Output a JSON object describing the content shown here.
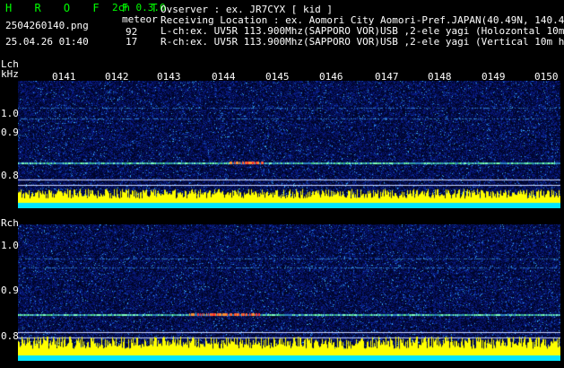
{
  "app_title": "H R O F F T",
  "mode": "2ch 0.3.0",
  "meteor_label": "meteor",
  "filename": "2504260140.png",
  "datetime": "25.04.26 01:40",
  "meteor_counts": {
    "lch": "92",
    "rch": "17"
  },
  "info": {
    "observer": "Ovserver             : ex. JR7CYX [ kid ]",
    "location": "Receiving Location : ex. Aomori City Aomori-Pref.JAPAN(40.49N, 140.47E)",
    "lch": "L-ch:ex. UV5R 113.900Mhz(SAPPORO VOR)USB ,2-ele yagi (Holozontal 10m height)",
    "rch": "R-ch:ex. UV5R 113.900Mhz(SAPPORO VOR)USB ,2-ele yagi (Vertical 10m height)"
  },
  "panels": {
    "lch": {
      "label": "Lch",
      "unit": "kHz",
      "y_ticks": [
        "1.0",
        "0.9",
        "0.8"
      ]
    },
    "rch": {
      "label": "Rch",
      "y_ticks": [
        "1.0",
        "0.9",
        "0.8"
      ]
    }
  },
  "time_ticks": [
    "0141",
    "0142",
    "0143",
    "0144",
    "0145",
    "0146",
    "0147",
    "0148",
    "0149",
    "0150"
  ],
  "colors": {
    "background": "#000000",
    "text_cyan": "#00ffff",
    "title_green": "#00ff00",
    "spectrum_noise": "#0a1a7a",
    "amplitude_bar": "#ffff00",
    "amplitude_floor": "#00e5ff"
  }
}
